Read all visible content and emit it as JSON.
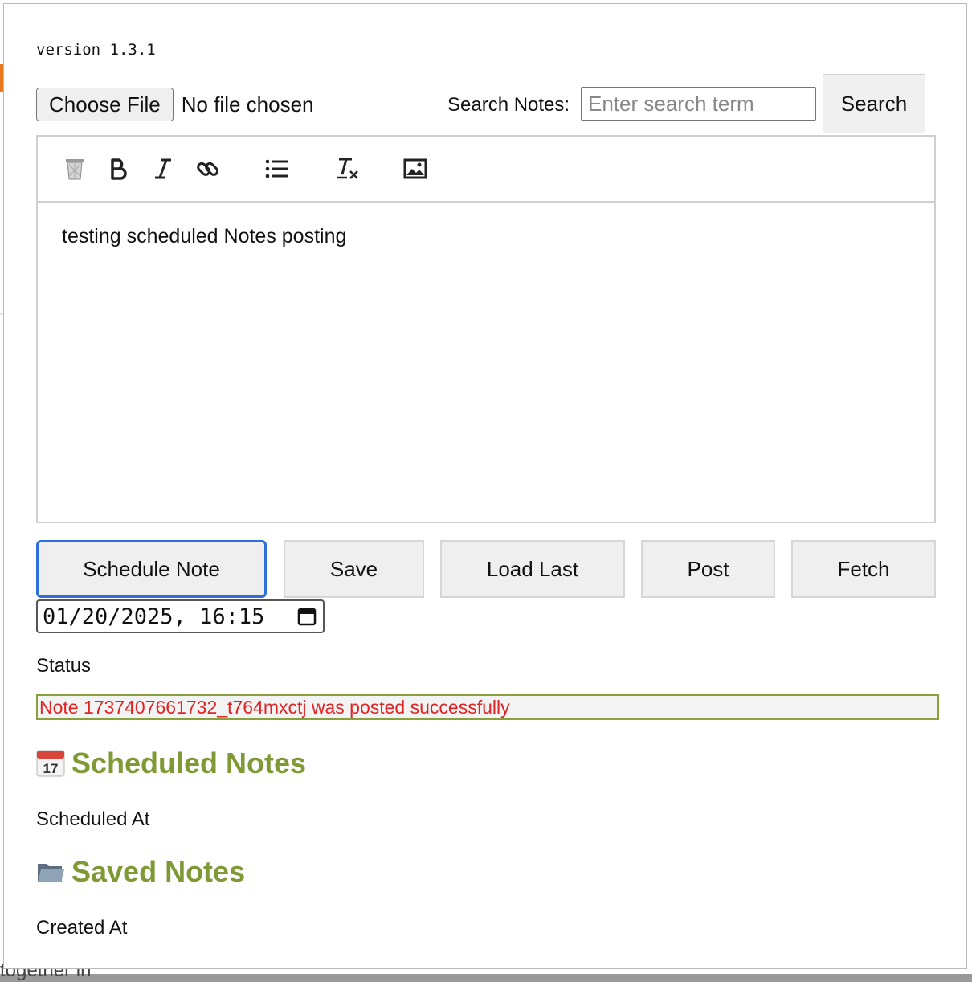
{
  "version": "version 1.3.1",
  "file_input": {
    "button_label": "Choose File",
    "status": "No file chosen"
  },
  "search": {
    "label": "Search Notes:",
    "placeholder": "Enter search term",
    "button_label": "Search"
  },
  "editor": {
    "toolbar": [
      "trash-icon",
      "bold-icon",
      "italic-icon",
      "link-icon",
      "list-icon",
      "clear-format-icon",
      "image-icon"
    ],
    "content": "testing scheduled Notes posting"
  },
  "actions": {
    "schedule": "Schedule Note",
    "save": "Save",
    "load_last": "Load Last",
    "post": "Post",
    "fetch": "Fetch"
  },
  "datetime_value": "01/20/2025, 16:15",
  "status": {
    "label": "Status",
    "message": "Note 1737407661732_t764mxctj was posted successfully"
  },
  "scheduled_section": {
    "icon": "calendar-icon",
    "title": "Scheduled Notes",
    "column": "Scheduled At"
  },
  "saved_section": {
    "icon": "folder-icon",
    "title": "Saved Notes",
    "column": "Created At"
  },
  "background": {
    "bottom_text": "together in"
  },
  "colors": {
    "accent": "#7f9934",
    "status_text": "#e02424",
    "focus": "#2f6fd8"
  }
}
